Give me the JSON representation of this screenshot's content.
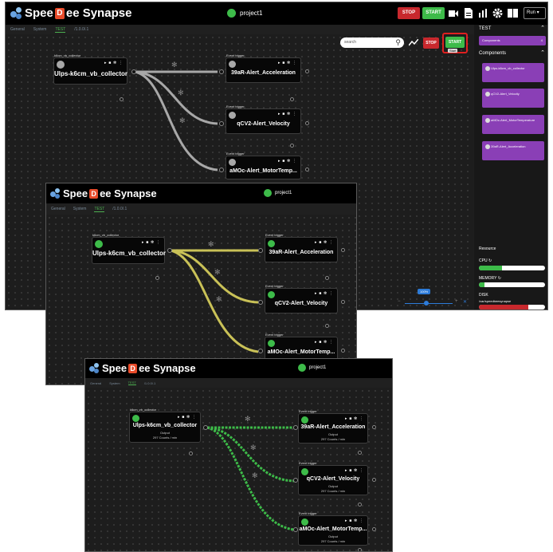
{
  "app": {
    "name_left": "Spee",
    "name_mark": "D",
    "name_right": "ee Synapse",
    "project": "project1"
  },
  "tabs": [
    "General",
    "System",
    "TEST",
    "/1.0.0/.1"
  ],
  "toolbar": {
    "search_placeholder": "search",
    "stop_label": "STOP",
    "start_label": "START",
    "run_label": "Run",
    "start_tooltip": "Start"
  },
  "nodes": {
    "collector": {
      "caption": "k6cm_vb_collector",
      "name": "Ulps-k6cm_vb_collector"
    },
    "acc": {
      "caption": "Event trigger",
      "name": "39aR-Alert_Acceleration"
    },
    "vel": {
      "caption": "Event trigger",
      "name": "qCV2-Alert_Velocity"
    },
    "temp": {
      "caption": "Event trigger",
      "name": "aMOc-Alert_MotorTemp..."
    }
  },
  "output": {
    "label": "Output",
    "value": "297 Counts / min"
  },
  "sidebar": {
    "title": "TEST",
    "components_chip": "Components",
    "components_count": "4",
    "components_header": "Components",
    "items": [
      "Ulps-k6cm_vb_collector",
      "qCV2-Alert_Velocity",
      "aMOc-Alert_MotorTemperature",
      "39aR-Alert_Acceleration"
    ],
    "resource_title": "Resource",
    "cpu_label": "CPU",
    "memory_label": "MEMORY",
    "disk_label": "DISK",
    "disk_path": "/var/speedbeesynapse",
    "cpu_fraction": 0.35,
    "memory_fraction": 0.08,
    "disk_fraction": 0.75
  },
  "zoom": {
    "label": "100%"
  },
  "colors": {
    "green": "#3dbb49",
    "yellow": "#c9c157",
    "grey": "#a8a8a8",
    "purple": "#8a3fb6",
    "red": "#c8282d",
    "link_blue": "#2d7bd8"
  }
}
